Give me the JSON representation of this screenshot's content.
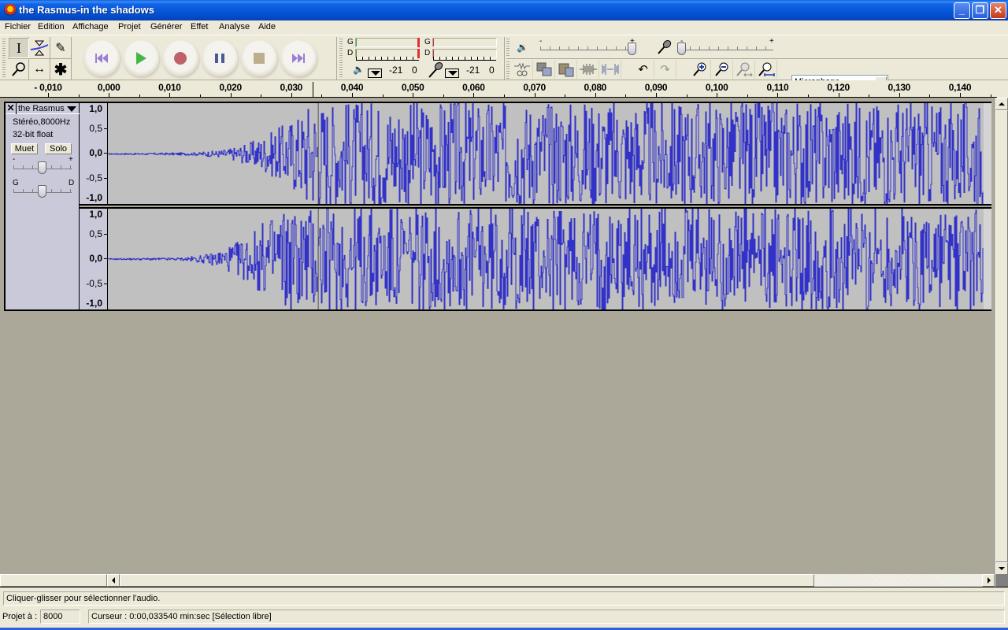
{
  "window": {
    "title": "the Rasmus-in the shadows",
    "controls": {
      "minimize": "_",
      "restore": "❐",
      "close": "✕"
    }
  },
  "menu": [
    "Fichier",
    "Edition",
    "Affichage",
    "Projet",
    "Générer",
    "Effet",
    "Analyse",
    "Aide"
  ],
  "tools": {
    "selection": {
      "icon": "selection-tool-icon",
      "glyph": "I",
      "active": true
    },
    "envelope": {
      "icon": "envelope-tool-icon",
      "glyph": "⧖"
    },
    "draw": {
      "icon": "pencil-icon",
      "glyph": "✎"
    },
    "zoom": {
      "icon": "zoom-tool-icon",
      "glyph": "⚲"
    },
    "timeshift": {
      "icon": "time-shift-icon",
      "glyph": "↔"
    },
    "multi": {
      "icon": "multi-tool-icon",
      "glyph": "✱"
    }
  },
  "transport": [
    {
      "name": "skip-to-start",
      "color": "#9b7fd6"
    },
    {
      "name": "play",
      "color": "#43b84a"
    },
    {
      "name": "record",
      "color": "#c0616a"
    },
    {
      "name": "pause",
      "color": "#4a5a98"
    },
    {
      "name": "stop",
      "color": "#bcae8e"
    },
    {
      "name": "skip-to-end",
      "color": "#9b7fd6"
    }
  ],
  "meters": {
    "output": {
      "left_label": "G",
      "right_label": "D",
      "scale_mid": "-21",
      "scale_max": "0"
    },
    "input": {
      "left_label": "G",
      "right_label": "D",
      "scale_mid": "-21",
      "scale_max": "0"
    }
  },
  "mixer": {
    "output_volume_min": "-",
    "output_volume_max": "+",
    "output_volume": 1.0,
    "input_volume_min": "-",
    "input_volume_max": "+",
    "input_volume": 0.0,
    "input_source": "Microphone"
  },
  "edit_toolbar": [
    "cut",
    "copy",
    "paste",
    "trim",
    "silence",
    "undo",
    "redo",
    "zoom-in",
    "zoom-out",
    "fit-selection",
    "fit-project"
  ],
  "ruler": {
    "labels": [
      "- 0,010",
      "0,000",
      "0,010",
      "0,020",
      "0,030",
      "0,040",
      "0,050",
      "0,060",
      "0,070",
      "0,080",
      "0,090",
      "0,100",
      "0,110",
      "0,120",
      "0,130",
      "0,140"
    ],
    "start_seconds": -0.01,
    "step_seconds": 0.01,
    "cursor_seconds": 0.03354
  },
  "track": {
    "name": "the Rasmus",
    "close": "✕",
    "format": "Stéréo,8000Hz",
    "bit_depth": "32-bit float",
    "mute_label": "Muet",
    "solo_label": "Solo",
    "gain_min": "-",
    "gain_max": "+",
    "pan_left": "G",
    "pan_right": "D",
    "gain": 0.5,
    "pan": 0.5,
    "vscale": [
      "1,0",
      "0,5",
      "0,0",
      "-0,5",
      "-1,0"
    ],
    "waveform_color": "#3232c8"
  },
  "status": {
    "hint": "Cliquer-glisser pour sélectionner l'audio.",
    "project_rate_label": "Projet à :",
    "project_rate": "8000",
    "cursor": "Curseur : 0:00,033540 min:sec   [Sélection libre]"
  }
}
